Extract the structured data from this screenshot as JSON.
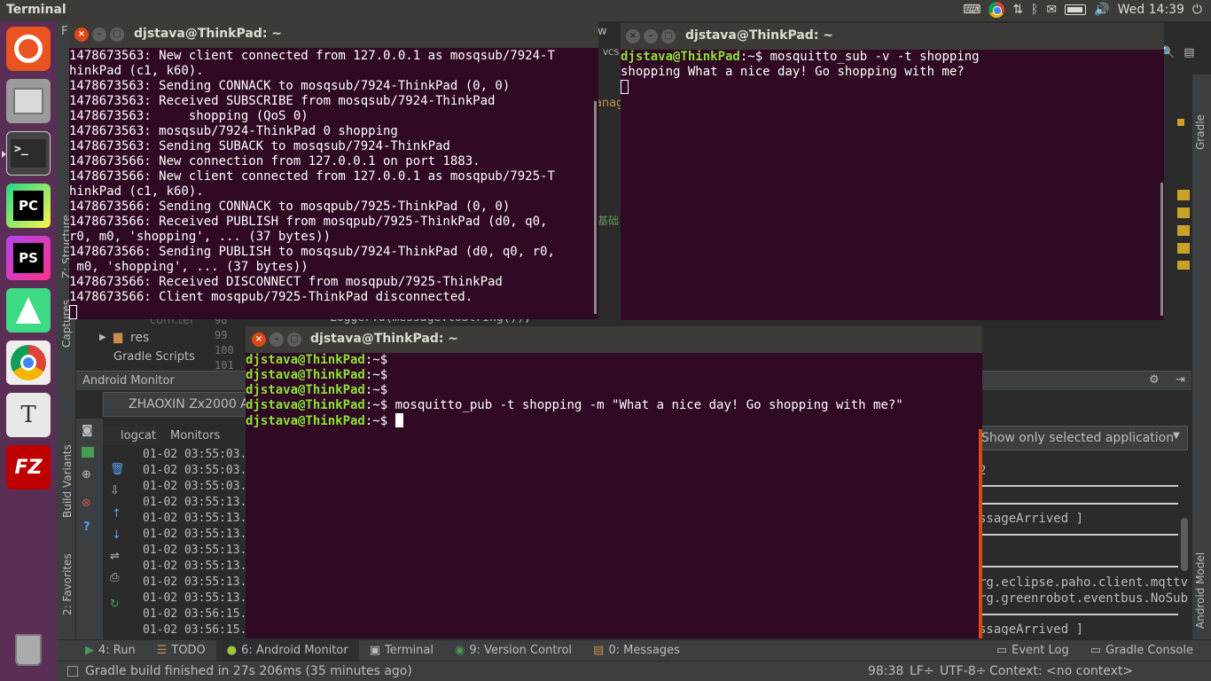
{
  "topbar": {
    "title": "Terminal",
    "clock": "Wed 14:39",
    "icons": [
      "keyboard-icon",
      "chrome-icon",
      "network-icon",
      "bluetooth-icon",
      "mail-icon",
      "battery-icon",
      "volume-icon",
      "power-icon"
    ]
  },
  "launcher": {
    "items": [
      {
        "name": "ubuntu-icon",
        "color": "#e95420"
      },
      {
        "name": "files-icon",
        "color": "#a9a9a9"
      },
      {
        "name": "terminal-icon",
        "color": "#2c2c2c",
        "label": ">_"
      },
      {
        "name": "pycharm-icon",
        "color": "#21d789",
        "label": "PC"
      },
      {
        "name": "phpstorm-icon",
        "color": "#b345f1",
        "label": "PS"
      },
      {
        "name": "android-studio-icon",
        "color": "#3ddc84"
      },
      {
        "name": "chrome-icon",
        "color": "#4285f4"
      },
      {
        "name": "text-editor-icon",
        "color": "#f0f0f0",
        "label": "T"
      },
      {
        "name": "filezilla-icon",
        "color": "#bf0000",
        "label": "FZ"
      },
      {
        "name": "trash-icon",
        "color": "#888888"
      }
    ]
  },
  "term1": {
    "title": "djstava@ThinkPad: ~",
    "lines": [
      "1478673563: New client connected from 127.0.0.1 as mosqsub/7924-T",
      "hinkPad (c1, k60).",
      "1478673563: Sending CONNACK to mosqsub/7924-ThinkPad (0, 0)",
      "1478673563: Received SUBSCRIBE from mosqsub/7924-ThinkPad",
      "1478673563:     shopping (QoS 0)",
      "1478673563: mosqsub/7924-ThinkPad 0 shopping",
      "1478673563: Sending SUBACK to mosqsub/7924-ThinkPad",
      "1478673566: New connection from 127.0.0.1 on port 1883.",
      "1478673566: New client connected from 127.0.0.1 as mosqpub/7925-T",
      "hinkPad (c1, k60).",
      "1478673566: Sending CONNACK to mosqpub/7925-ThinkPad (0, 0)",
      "1478673566: Received PUBLISH from mosqpub/7925-ThinkPad (d0, q0,",
      "r0, m0, 'shopping', ... (37 bytes))",
      "1478673566: Sending PUBLISH to mosqsub/7924-ThinkPad (d0, q0, r0,",
      " m0, 'shopping', ... (37 bytes))",
      "1478673566: Received DISCONNECT from mosqpub/7925-ThinkPad",
      "1478673566: Client mosqpub/7925-ThinkPad disconnected."
    ]
  },
  "term2": {
    "title": "djstava@ThinkPad: ~",
    "prompt": "djstava@ThinkPad",
    "suffix": ":~$ ",
    "command": "mosquitto_sub -v -t shopping",
    "output": "shopping What a nice day! Go shopping with me?"
  },
  "term3": {
    "title": "djstava@ThinkPad: ~",
    "prompt": "djstava@ThinkPad",
    "suffix": ":~$ ",
    "command": "mosquitto_pub -t shopping -m \"What a nice day! Go shopping with me?\""
  },
  "ide": {
    "frag_f": "F",
    "frag_w": "w",
    "frag_vcs": "VCS",
    "frag_ana": "anag",
    "frag_cn": "基础",
    "code_line": "Logger.d(message.toString());",
    "project_com": "com.tel",
    "project_res": "res",
    "project_gradle": "Gradle Scripts",
    "line_numbers": [
      "98",
      "99",
      "100",
      "101"
    ],
    "android_monitor_label": "Android Monitor",
    "device": "ZHAOXIN Zx2000 Ar",
    "logcat_tab": "logcat",
    "monitors_tab": "Monitors",
    "filter_dropdown": "Show only selected application",
    "log_times": [
      "01-02 03:55:03.",
      "01-02 03:55:03.",
      "01-02 03:55:03.",
      "01-02 03:55:13.",
      "01-02 03:55:13.",
      "01-02 03:55:13.",
      "01-02 03:55:13.",
      "01-02 03:55:13.",
      "01-02 03:55:13.",
      "01-02 03:55:13.",
      "01-02 03:56:15.",
      "01-02 03:56:15."
    ],
    "right_log": {
      "a": "2",
      "b": "ssageArrived ]",
      "c": "rg.eclipse.paho.client.mqttv",
      "d": "rg.greenrobot.eventbus.NoSub",
      "e": "ssageArrived ]"
    },
    "left_tabs": [
      "Captures",
      "Z: Structure",
      "Build Variants",
      "2: Favorites"
    ],
    "right_tabs": [
      "Gradle",
      "Android Model"
    ],
    "bottom_tabs": [
      {
        "label": "4: Run",
        "icon": "run-icon"
      },
      {
        "label": "TODO",
        "icon": "todo-icon"
      },
      {
        "label": "6: Android Monitor",
        "icon": "android-icon"
      },
      {
        "label": "Terminal",
        "icon": "terminal-icon"
      },
      {
        "label": "9: Version Control",
        "icon": "vcs-icon"
      },
      {
        "label": "0: Messages",
        "icon": "messages-icon"
      }
    ],
    "bottom_right_tabs": [
      {
        "label": "Event Log",
        "icon": "event-log-icon"
      },
      {
        "label": "Gradle Console",
        "icon": "gradle-console-icon"
      }
    ],
    "status": "Gradle build finished in 27s 206ms (35 minutes ago)",
    "position": "98:38",
    "line_sep": "LF÷",
    "encoding": "UTF-8÷",
    "context": "Context: <no context>"
  }
}
